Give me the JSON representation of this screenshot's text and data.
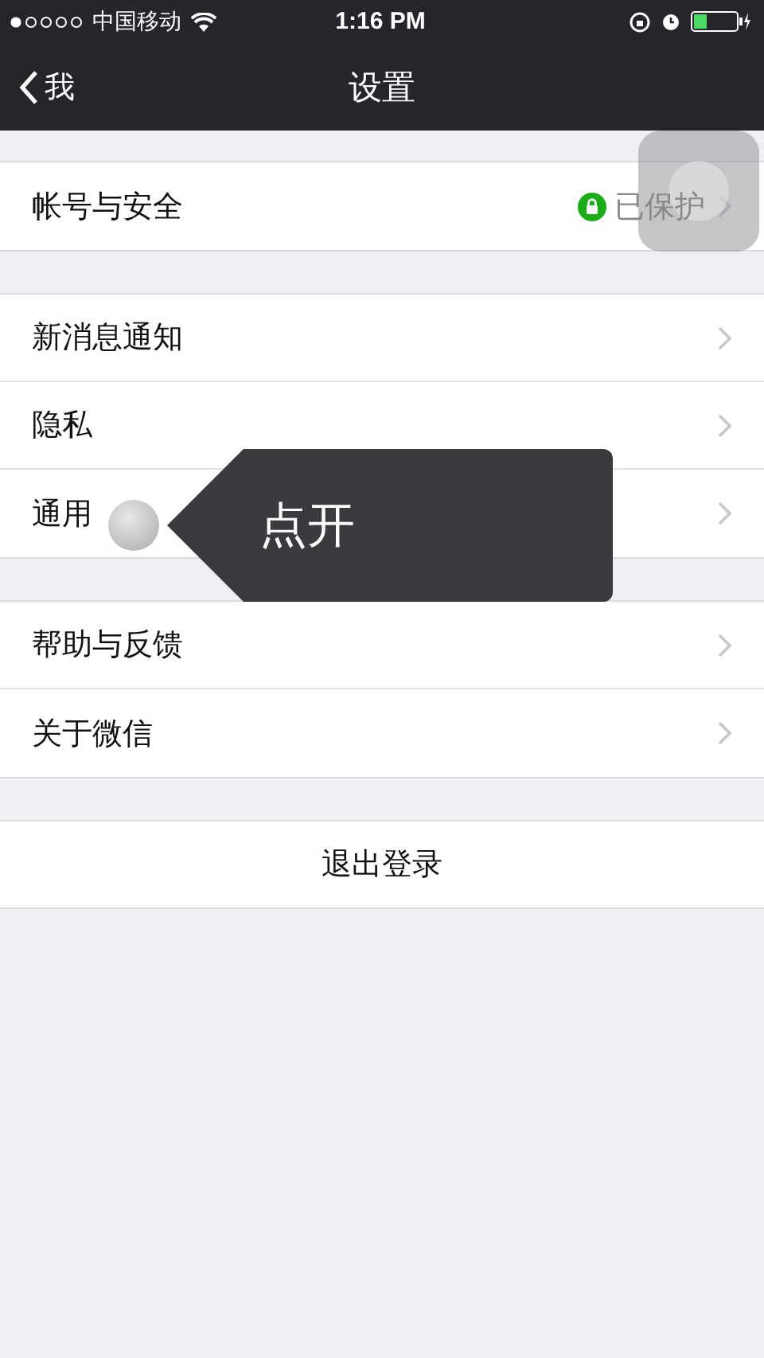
{
  "status_bar": {
    "carrier": "中国移动",
    "time": "1:16 PM"
  },
  "nav": {
    "back_label": "我",
    "title": "设置"
  },
  "groups": [
    [
      {
        "kind": "status",
        "label": "帐号与安全",
        "value": "已保护"
      }
    ],
    [
      {
        "kind": "link",
        "label": "新消息通知"
      },
      {
        "kind": "link",
        "label": "隐私"
      },
      {
        "kind": "link",
        "label": "通用"
      }
    ],
    [
      {
        "kind": "link",
        "label": "帮助与反馈"
      },
      {
        "kind": "link",
        "label": "关于微信"
      }
    ]
  ],
  "logout": {
    "label": "退出登录"
  },
  "tooltip": {
    "text": "点开"
  }
}
